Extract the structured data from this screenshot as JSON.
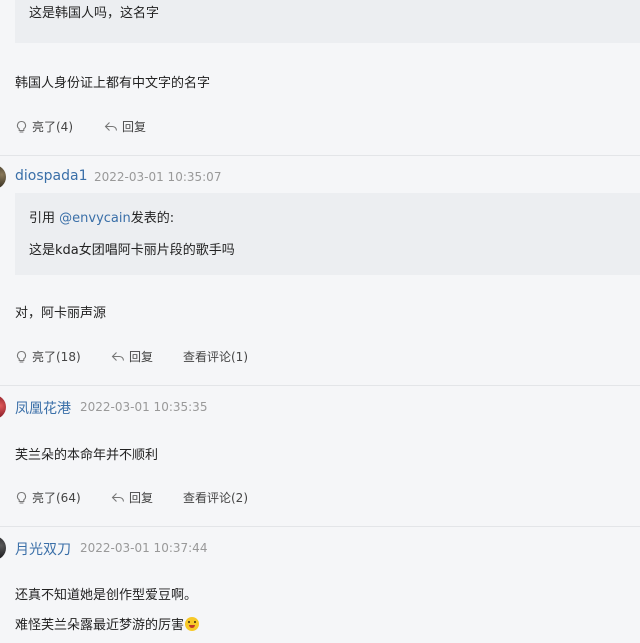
{
  "comment_top": {
    "quote_text": "这是韩国人吗，这名字",
    "body": "韩国人身份证上都有中文字的名字",
    "like_label": "亮了(4)",
    "reply_label": "回复"
  },
  "comment_1": {
    "username": "diospada1",
    "timestamp": "2022-03-01 10:35:07",
    "quote_prefix": "引用 ",
    "quote_mention": "@envycain",
    "quote_suffix": "发表的:",
    "quote_body": "这是kda女团唱阿卡丽片段的歌手吗",
    "body": "对，阿卡丽声源",
    "like_label": "亮了(18)",
    "reply_label": "回复",
    "view_comments_label": "查看评论(1)"
  },
  "comment_2": {
    "username": "凤凰花港",
    "timestamp": "2022-03-01 10:35:35",
    "body": "芙兰朵的本命年并不顺利",
    "like_label": "亮了(64)",
    "reply_label": "回复",
    "view_comments_label": "查看评论(2)"
  },
  "comment_3": {
    "username": "月光双刀",
    "timestamp": "2022-03-01 10:37:44",
    "body_line1": "还真不知道她是创作型爱豆啊。",
    "body_line2": "难怪芙兰朵露最近梦游的厉害"
  },
  "colors": {
    "username": "#3a6fa8",
    "timestamp": "#999999",
    "quote_bg": "#eceef1",
    "page_bg": "#f5f6f8"
  },
  "icons": {
    "like": "lightbulb-icon",
    "reply": "reply-arrow-icon",
    "emoji": "grinning-face-emoji"
  }
}
